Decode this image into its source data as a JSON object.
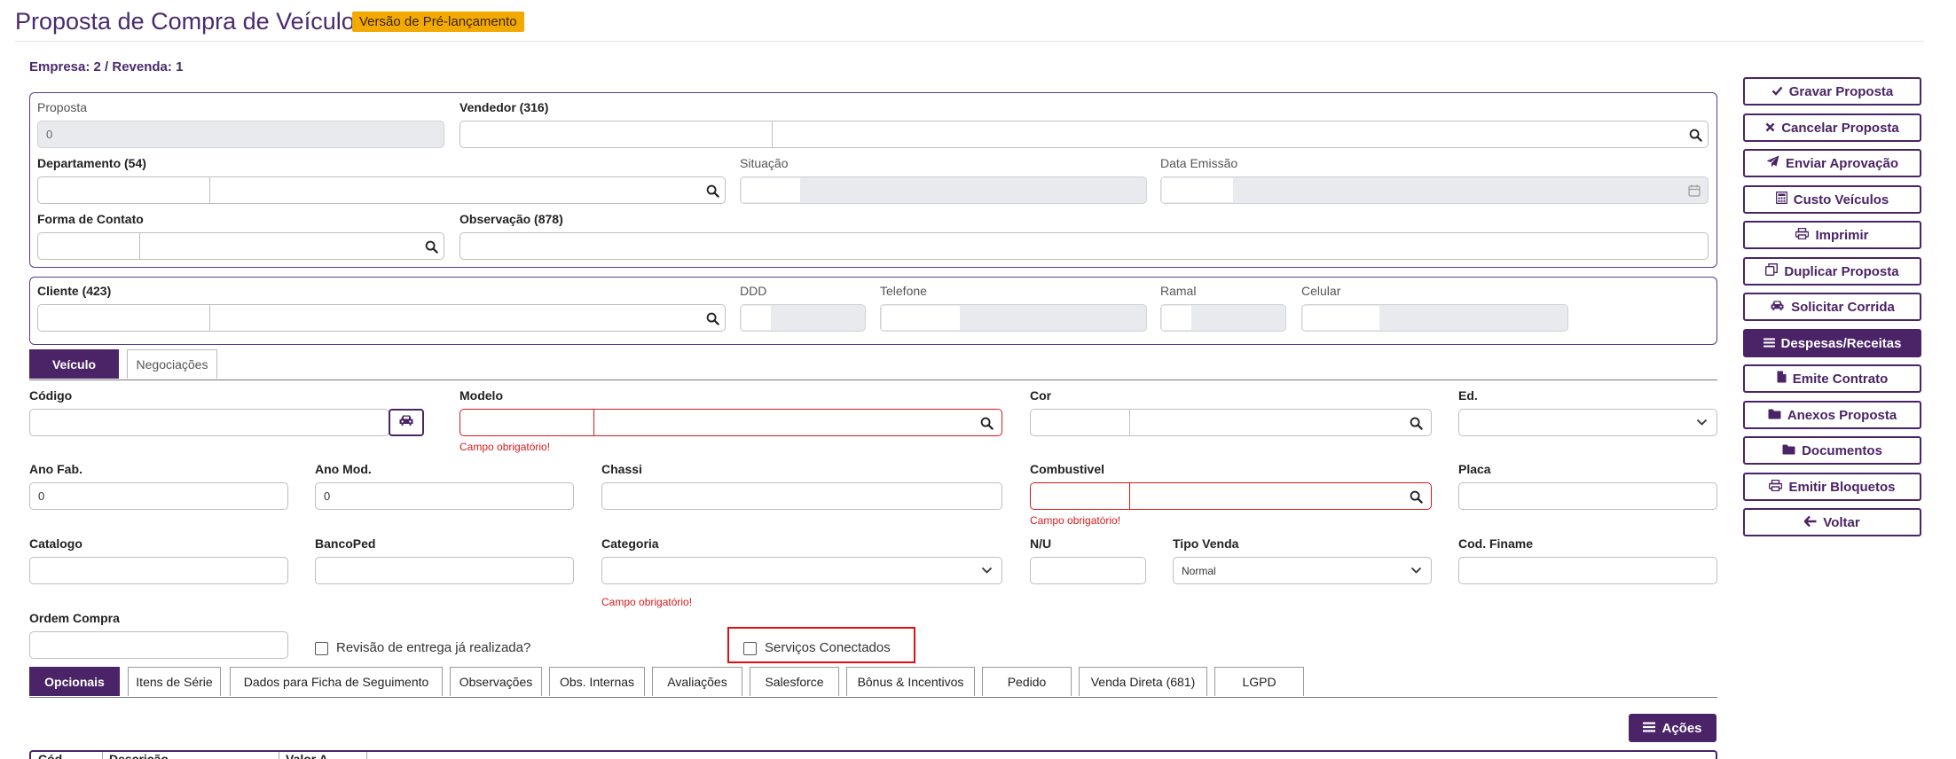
{
  "header": {
    "title": "Proposta de Compra de Veículo",
    "badge": "Versão de Pré-lançamento",
    "empresa": "Empresa: 2 / Revenda: 1"
  },
  "proposal": {
    "proposta_label": "Proposta",
    "proposta_value": "0",
    "vendedor_label": "Vendedor (316)",
    "departamento_label": "Departamento (54)",
    "situacao_label": "Situação",
    "data_emissao_label": "Data Emissão",
    "forma_contato_label": "Forma de Contato",
    "observacao_label": "Observação (878)"
  },
  "cliente": {
    "cliente_label": "Cliente (423)",
    "ddd_label": "DDD",
    "telefone_label": "Telefone",
    "ramal_label": "Ramal",
    "celular_label": "Celular"
  },
  "top_tabs": [
    "Veículo",
    "Negociações"
  ],
  "vehicle": {
    "codigo_label": "Código",
    "modelo_label": "Modelo",
    "cor_label": "Cor",
    "ed_label": "Ed.",
    "ano_fab_label": "Ano Fab.",
    "ano_fab_value": "0",
    "ano_mod_label": "Ano Mod.",
    "ano_mod_value": "0",
    "chassi_label": "Chassi",
    "combustivel_label": "Combustivel",
    "placa_label": "Placa",
    "catalogo_label": "Catalogo",
    "bancoped_label": "BancoPed",
    "categoria_label": "Categoria",
    "nu_label": "N/U",
    "tipo_venda_label": "Tipo Venda",
    "tipo_venda_value": "Normal",
    "cod_finame_label": "Cod. Finame",
    "ordem_compra_label": "Ordem Compra",
    "revisao_label": "Revisão de entrega já realizada?",
    "servicos_label": "Serviços Conectados",
    "required_msg": "Campo obrigatório!"
  },
  "bottom_tabs": [
    "Opcionais",
    "Itens de Série",
    "Dados para Ficha de Seguimento",
    "Observações",
    "Obs. Internas",
    "Avaliações",
    "Salesforce",
    "Bônus & Incentivos",
    "Pedido",
    "Venda Direta (681)",
    "LGPD"
  ],
  "acoes_label": "Ações",
  "grid_headers": [
    "Cód...",
    "Descrição",
    "Valor A..."
  ],
  "actions": [
    {
      "label": "Gravar Proposta",
      "icon": "check-icon"
    },
    {
      "label": "Cancelar Proposta",
      "icon": "close-icon"
    },
    {
      "label": "Enviar Aprovação",
      "icon": "send-icon"
    },
    {
      "label": "Custo Veículos",
      "icon": "calculator-icon"
    },
    {
      "label": "Imprimir",
      "icon": "print-icon"
    },
    {
      "label": "Duplicar Proposta",
      "icon": "copy-icon"
    },
    {
      "label": "Solicitar Corrida",
      "icon": "car-icon"
    },
    {
      "label": "Despesas/Receitas",
      "icon": "list-icon"
    },
    {
      "label": "Emite Contrato",
      "icon": "file-icon"
    },
    {
      "label": "Anexos Proposta",
      "icon": "folder-icon"
    },
    {
      "label": "Documentos",
      "icon": "folder-icon"
    },
    {
      "label": "Emitir Bloquetos",
      "icon": "print-icon"
    },
    {
      "label": "Voltar",
      "icon": "arrow-left-icon"
    }
  ],
  "colors": {
    "brand": "#4a2466",
    "badge": "#f2a900",
    "error": "#d81b1b"
  }
}
